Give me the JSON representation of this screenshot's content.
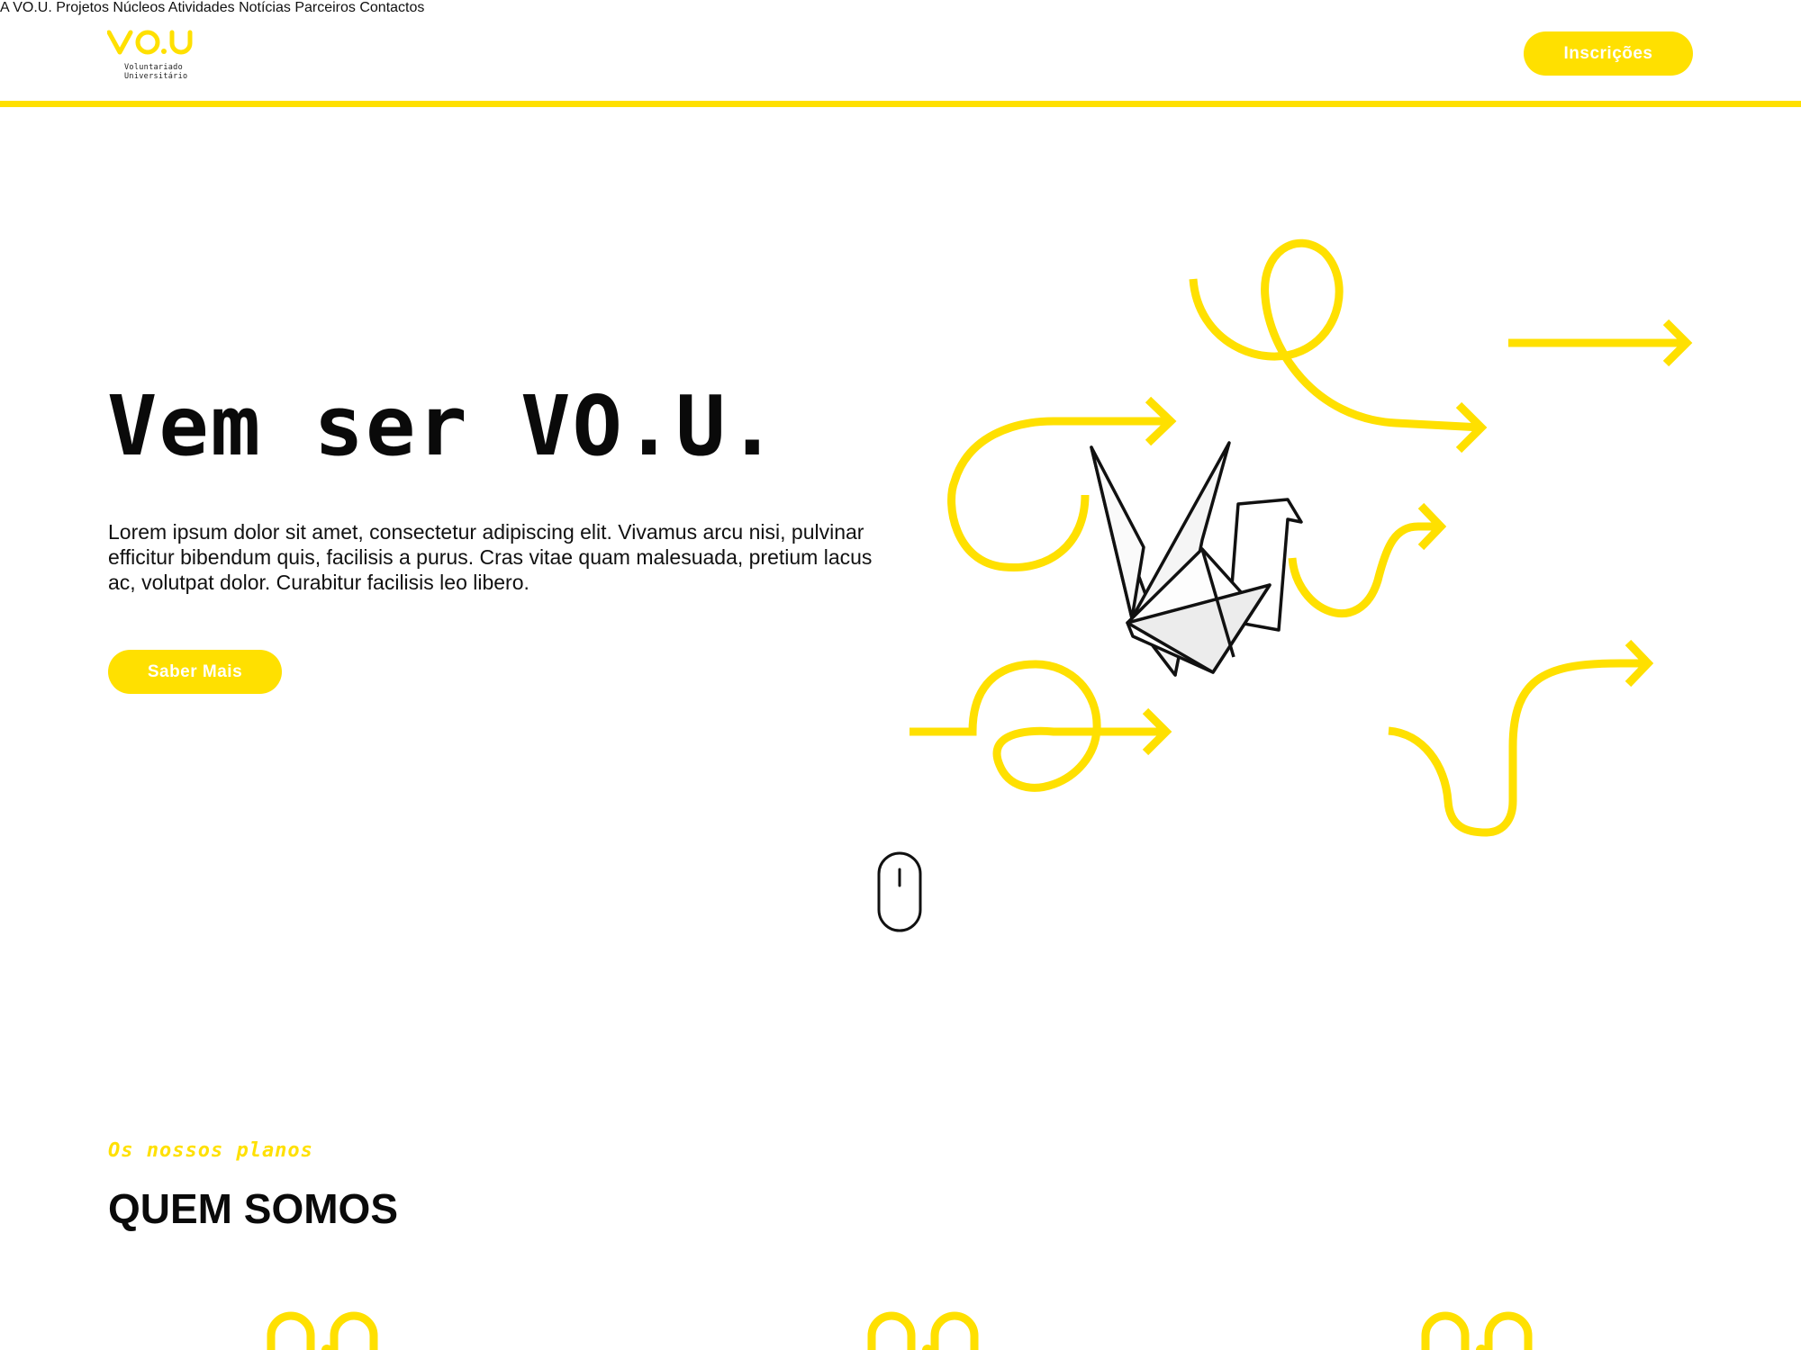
{
  "brand": {
    "logo_text": "VO.U",
    "logo_subtitle": "Voluntariado\nUniversitário"
  },
  "nav": {
    "items": [
      {
        "label": "A VO.U."
      },
      {
        "label": "Projetos"
      },
      {
        "label": "Núcleos"
      },
      {
        "label": "Atividades"
      },
      {
        "label": "Notícias"
      },
      {
        "label": "Parceiros"
      },
      {
        "label": "Contactos"
      }
    ],
    "cta_label": "Inscrições"
  },
  "hero": {
    "title": "Vem ser VO.U.",
    "text": "Lorem ipsum dolor sit amet, consectetur adipiscing elit. Vivamus arcu nisi, pulvinar efficitur bibendum quis, facilisis a purus. Cras vitae quam malesuada, pretium lacus ac, volutpat dolor. Curabitur facilisis leo libero.",
    "button_label": "Saber Mais"
  },
  "section": {
    "kicker": "Os nossos planos",
    "title": "QUEM SOMOS"
  },
  "colors": {
    "accent": "#FFE000",
    "text": "#111111",
    "background": "#FFFFFF"
  },
  "icons": [
    "origami-crane-illustration",
    "scroll-mouse-icon",
    "arrow-icon"
  ]
}
